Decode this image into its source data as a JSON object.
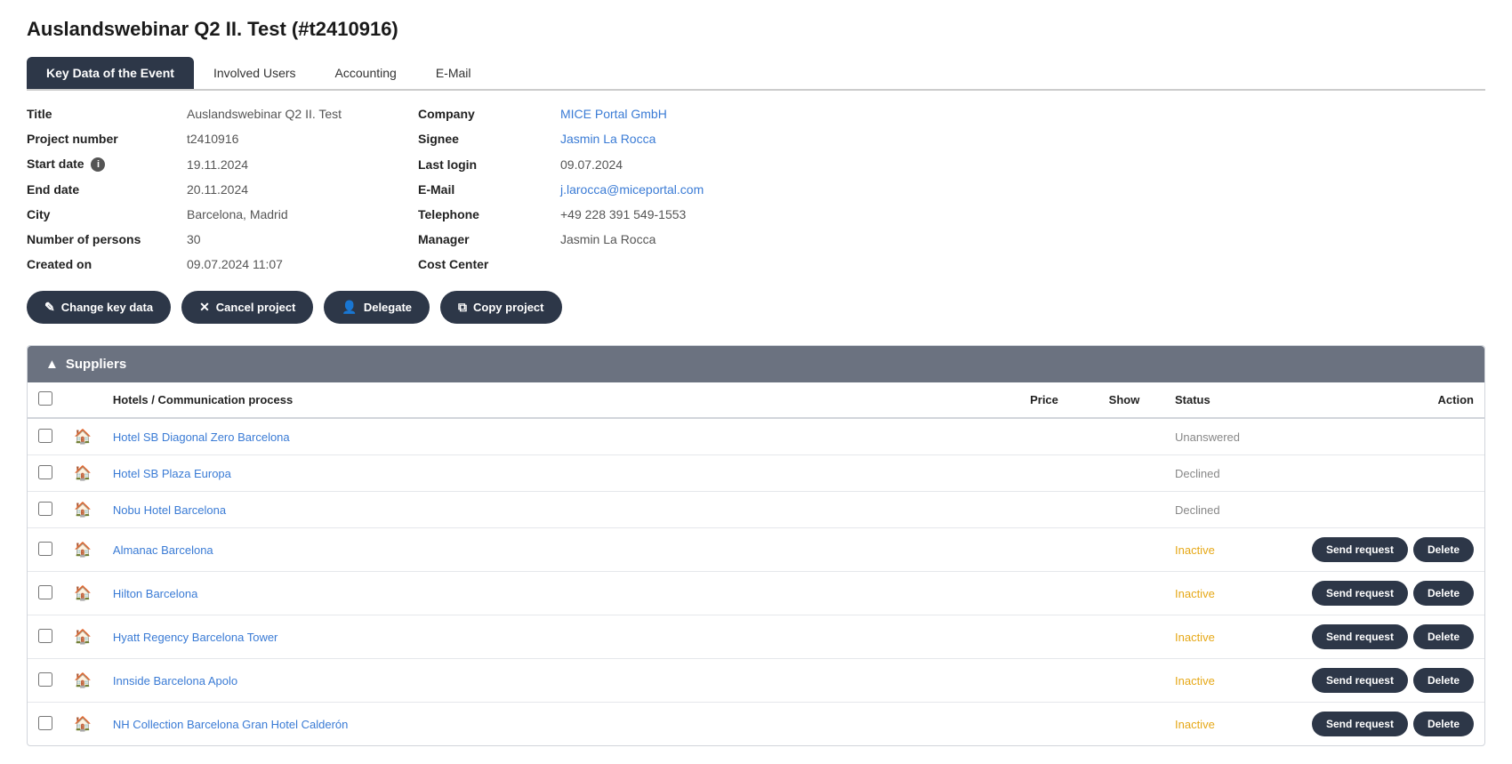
{
  "page": {
    "title": "Auslandswebinar Q2 II. Test (#t2410916)"
  },
  "tabs": [
    {
      "id": "key-data",
      "label": "Key Data of the Event",
      "active": true
    },
    {
      "id": "involved-users",
      "label": "Involved Users",
      "active": false
    },
    {
      "id": "accounting",
      "label": "Accounting",
      "active": false
    },
    {
      "id": "email",
      "label": "E-Mail",
      "active": false
    }
  ],
  "keyData": {
    "left": [
      {
        "label": "Title",
        "value": "Auslandswebinar Q2 II. Test",
        "hasInfo": false
      },
      {
        "label": "Project number",
        "value": "t2410916",
        "hasInfo": false
      },
      {
        "label": "Start date",
        "value": "19.11.2024",
        "hasInfo": true
      },
      {
        "label": "End date",
        "value": "20.11.2024",
        "hasInfo": false
      },
      {
        "label": "City",
        "value": "Barcelona, Madrid",
        "hasInfo": false
      },
      {
        "label": "Number of persons",
        "value": "30",
        "hasInfo": false
      },
      {
        "label": "Created on",
        "value": "09.07.2024 11:07",
        "hasInfo": false
      }
    ],
    "right": [
      {
        "label": "Company",
        "value": "MICE Portal GmbH",
        "isLink": true
      },
      {
        "label": "Signee",
        "value": "Jasmin La Rocca",
        "isLink": true
      },
      {
        "label": "Last login",
        "value": "09.07.2024",
        "isLink": false
      },
      {
        "label": "E-Mail",
        "value": "j.larocca@miceportal.com",
        "isLink": true
      },
      {
        "label": "Telephone",
        "value": "+49 228 391 549-1553",
        "isLink": false
      },
      {
        "label": "Manager",
        "value": "Jasmin La Rocca",
        "isLink": false
      },
      {
        "label": "Cost Center",
        "value": "",
        "isLink": false
      }
    ]
  },
  "actions": [
    {
      "id": "change-key-data",
      "label": "Change key data",
      "icon": "✎"
    },
    {
      "id": "cancel-project",
      "label": "Cancel project",
      "icon": "✕"
    },
    {
      "id": "delegate",
      "label": "Delegate",
      "icon": "👤"
    },
    {
      "id": "copy-project",
      "label": "Copy project",
      "icon": "⧉"
    }
  ],
  "suppliers": {
    "sectionTitle": "Suppliers",
    "columns": {
      "name": "Hotels / Communication process",
      "price": "Price",
      "show": "Show",
      "status": "Status",
      "action": "Action"
    },
    "rows": [
      {
        "id": 1,
        "name": "Hotel SB Diagonal Zero Barcelona",
        "price": "",
        "show": "",
        "status": "Unanswered",
        "statusClass": "unanswered",
        "hasActions": false
      },
      {
        "id": 2,
        "name": "Hotel SB Plaza Europa",
        "price": "",
        "show": "",
        "status": "Declined",
        "statusClass": "declined",
        "hasActions": false
      },
      {
        "id": 3,
        "name": "Nobu Hotel Barcelona",
        "price": "",
        "show": "",
        "status": "Declined",
        "statusClass": "declined",
        "hasActions": false
      },
      {
        "id": 4,
        "name": "Almanac Barcelona",
        "price": "",
        "show": "",
        "status": "Inactive",
        "statusClass": "inactive",
        "hasActions": true
      },
      {
        "id": 5,
        "name": "Hilton Barcelona",
        "price": "",
        "show": "",
        "status": "Inactive",
        "statusClass": "inactive",
        "hasActions": true
      },
      {
        "id": 6,
        "name": "Hyatt Regency Barcelona Tower",
        "price": "",
        "show": "",
        "status": "Inactive",
        "statusClass": "inactive",
        "hasActions": true
      },
      {
        "id": 7,
        "name": "Innside Barcelona Apolo",
        "price": "",
        "show": "",
        "status": "Inactive",
        "statusClass": "inactive",
        "hasActions": true
      },
      {
        "id": 8,
        "name": "NH Collection Barcelona Gran Hotel Calderón",
        "price": "",
        "show": "",
        "status": "Inactive",
        "statusClass": "inactive",
        "hasActions": true
      }
    ],
    "sendRequestLabel": "Send request",
    "deleteLabel": "Delete"
  }
}
